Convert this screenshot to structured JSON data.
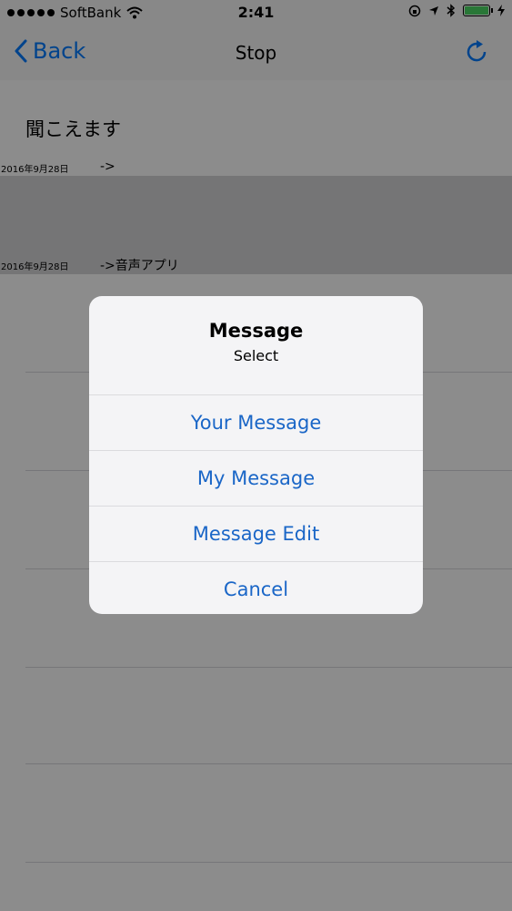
{
  "status_bar": {
    "carrier": "SoftBank",
    "time": "2:41",
    "battery_color": "#4cd964"
  },
  "nav": {
    "back_label": "Back",
    "title": "Stop",
    "refresh_icon": "refresh-icon"
  },
  "content": {
    "heading": "聞こえます",
    "rows": [
      {
        "date": "2016年9月28日",
        "text": "->"
      },
      {
        "date": "2016年9月28日",
        "text": "->音声アプリ"
      }
    ]
  },
  "alert": {
    "title": "Message",
    "message": "Select",
    "actions": [
      "Your Message",
      "My Message",
      "Message Edit",
      "Cancel"
    ],
    "action_color": "#1a66c7"
  }
}
